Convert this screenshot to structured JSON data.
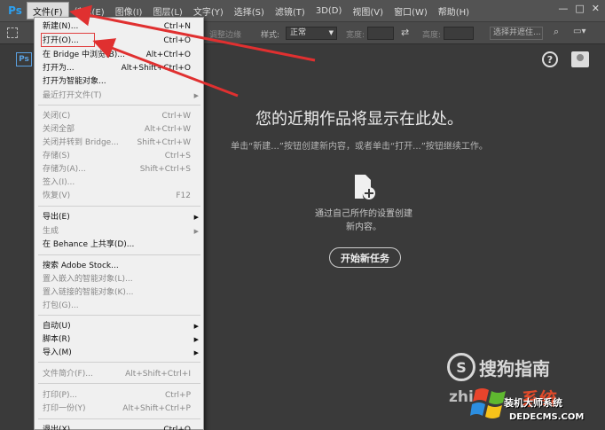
{
  "app": {
    "logo": "Ps"
  },
  "menubar": {
    "items": [
      "文件(F)",
      "编辑(E)",
      "图像(I)",
      "图层(L)",
      "文字(Y)",
      "选择(S)",
      "滤镜(T)",
      "3D(D)",
      "视图(V)",
      "窗口(W)",
      "帮助(H)"
    ]
  },
  "window_controls": {
    "minimize": "—",
    "maximize": "□",
    "close": "✕"
  },
  "options_bar": {
    "feather_label": "调整边缘",
    "style_label": "样式:",
    "style_value": "正常",
    "width_label": "宽度:",
    "height_label": "高度:",
    "select_region": "选择并遮住..."
  },
  "workspace": {
    "doc_badge": "Ps",
    "help": "?",
    "title": "您的近期作品将显示在此处。",
    "subtitle": "单击“新建...”按钮创建新内容，或者单击“打开...”按钮继续工作。",
    "create_line1": "通过自己所作的设置创建",
    "create_line2": "新内容。",
    "start_button": "开始新任务"
  },
  "file_menu": {
    "items": [
      {
        "label": "新建(N)...",
        "shortcut": "Ctrl+N",
        "disabled": false
      },
      {
        "label": "打开(O)...",
        "shortcut": "Ctrl+O",
        "disabled": false
      },
      {
        "label": "在 Bridge 中浏览(B)...",
        "shortcut": "Alt+Ctrl+O",
        "disabled": false
      },
      {
        "label": "打开为...",
        "shortcut": "Alt+Shift+Ctrl+O",
        "disabled": false
      },
      {
        "label": "打开为智能对象...",
        "shortcut": "",
        "disabled": false
      },
      {
        "label": "最近打开文件(T)",
        "shortcut": "",
        "disabled": true,
        "submenu": true
      },
      {
        "label": "关闭(C)",
        "shortcut": "Ctrl+W",
        "disabled": true
      },
      {
        "label": "关闭全部",
        "shortcut": "Alt+Ctrl+W",
        "disabled": true
      },
      {
        "label": "关闭并转到 Bridge...",
        "shortcut": "Shift+Ctrl+W",
        "disabled": true
      },
      {
        "label": "存储(S)",
        "shortcut": "Ctrl+S",
        "disabled": true
      },
      {
        "label": "存储为(A)...",
        "shortcut": "Shift+Ctrl+S",
        "disabled": true
      },
      {
        "label": "签入(I)...",
        "shortcut": "",
        "disabled": true
      },
      {
        "label": "恢复(V)",
        "shortcut": "F12",
        "disabled": true
      },
      {
        "label": "导出(E)",
        "shortcut": "",
        "disabled": false,
        "submenu": true
      },
      {
        "label": "生成",
        "shortcut": "",
        "disabled": true,
        "submenu": true
      },
      {
        "label": "在 Behance 上共享(D)...",
        "shortcut": "",
        "disabled": false
      },
      {
        "label": "搜索 Adobe Stock...",
        "shortcut": "",
        "disabled": false
      },
      {
        "label": "置入嵌入的智能对象(L)...",
        "shortcut": "",
        "disabled": true
      },
      {
        "label": "置入链接的智能对象(K)...",
        "shortcut": "",
        "disabled": true
      },
      {
        "label": "打包(G)...",
        "shortcut": "",
        "disabled": true
      },
      {
        "label": "自动(U)",
        "shortcut": "",
        "disabled": false,
        "submenu": true
      },
      {
        "label": "脚本(R)",
        "shortcut": "",
        "disabled": false,
        "submenu": true
      },
      {
        "label": "导入(M)",
        "shortcut": "",
        "disabled": false,
        "submenu": true
      },
      {
        "label": "文件简介(F)...",
        "shortcut": "Alt+Shift+Ctrl+I",
        "disabled": true
      },
      {
        "label": "打印(P)...",
        "shortcut": "Ctrl+P",
        "disabled": true
      },
      {
        "label": "打印一份(Y)",
        "shortcut": "Alt+Shift+Ctrl+P",
        "disabled": true
      },
      {
        "label": "退出(X)",
        "shortcut": "Ctrl+Q",
        "disabled": false
      }
    ]
  },
  "watermarks": {
    "sogou_s": "S",
    "sogou": "搜狗指南",
    "zhi": "zhi",
    "xitong": "系统",
    "site_line1": "装机大师系统",
    "site_line2": "DEDECMS.COM"
  },
  "colors": {
    "arrow": "#e03030",
    "accent": "#2da0f0"
  }
}
